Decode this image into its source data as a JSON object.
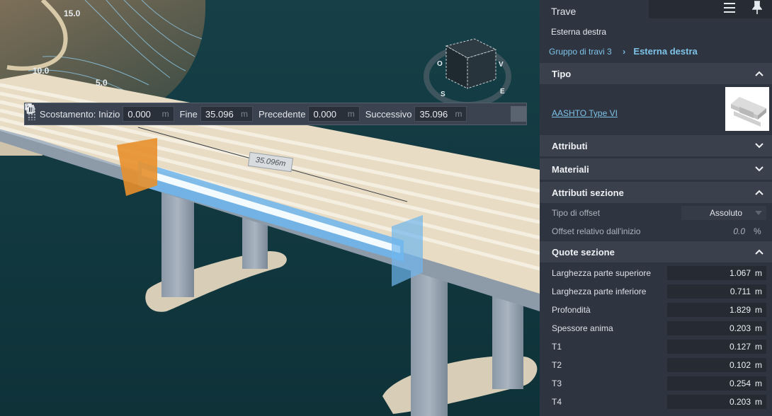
{
  "viewport": {
    "contour_labels": [
      "15.0",
      "10.0",
      "5.0"
    ],
    "viewcube_letters": [
      "O",
      "V",
      "S",
      "E"
    ],
    "dimension_label": "35.096m"
  },
  "toolbar": {
    "start_label": "Scostamento: Inizio",
    "start_value": "0.000",
    "end_label": "Fine",
    "end_value": "35.096",
    "prev_label": "Precedente",
    "prev_value": "0.000",
    "next_label": "Successivo",
    "next_value": "35.096",
    "unit": "m",
    "add_icon": "plus-icon",
    "copy_icon": "copy-icon",
    "delete_icon": "trash-icon"
  },
  "panel": {
    "title": "Trave",
    "subtitle": "Esterna destra",
    "breadcrumb": {
      "parent": "Gruppo di travi 3",
      "current": "Esterna destra"
    },
    "tipo": {
      "header": "Tipo",
      "type_link": "AASHTO Type VI"
    },
    "attributi": {
      "header": "Attributi"
    },
    "materiali": {
      "header": "Materiali"
    },
    "attributi_sezione": {
      "header": "Attributi sezione",
      "offset_type_label": "Tipo di offset",
      "offset_type_value": "Assoluto",
      "relative_offset_label": "Offset relativo dall'inizio",
      "relative_offset_value": "0.0",
      "relative_offset_unit": "%"
    },
    "quote_sezione": {
      "header": "Quote sezione",
      "rows": [
        {
          "label": "Larghezza parte superiore",
          "value": "1.067",
          "unit": "m"
        },
        {
          "label": "Larghezza parte inferiore",
          "value": "0.711",
          "unit": "m"
        },
        {
          "label": "Profondità",
          "value": "1.829",
          "unit": "m"
        },
        {
          "label": "Spessore anima",
          "value": "0.203",
          "unit": "m"
        },
        {
          "label": "T1",
          "value": "0.127",
          "unit": "m"
        },
        {
          "label": "T2",
          "value": "0.102",
          "unit": "m"
        },
        {
          "label": "T3",
          "value": "0.254",
          "unit": "m"
        },
        {
          "label": "T4",
          "value": "0.203",
          "unit": "m"
        }
      ]
    }
  },
  "colors": {
    "accent": "#7ec3e8",
    "panel_bg": "#2e3440",
    "section_bg": "#3a414d",
    "water": "#0f3a40",
    "selection_orange": "#e8902c",
    "selection_blue": "#6fb6ee"
  }
}
